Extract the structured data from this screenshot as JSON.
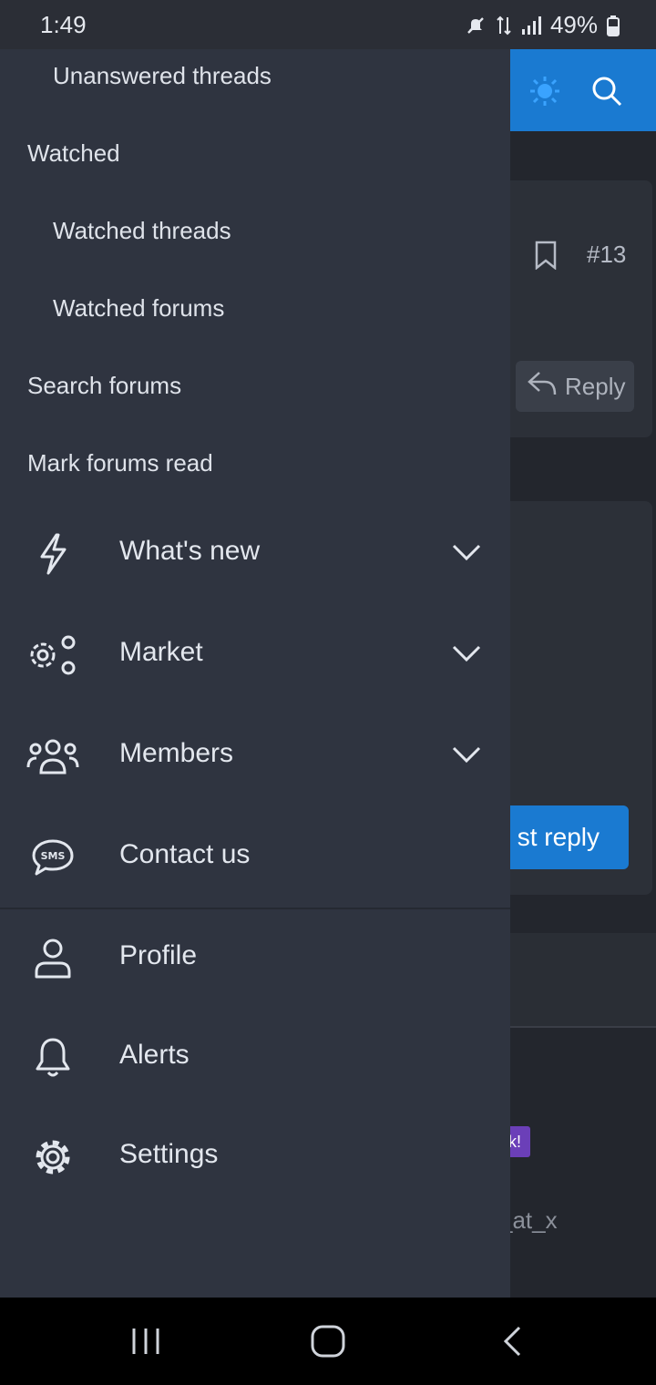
{
  "status_bar": {
    "time": "1:49",
    "battery": "49%"
  },
  "background": {
    "post_number": "#13",
    "reply_label": "Reply",
    "post_reply_fragment": "st reply",
    "badge_fragment": "k!",
    "username_fragment": "_at_x"
  },
  "drawer": {
    "links": [
      {
        "label": "Unanswered threads"
      },
      {
        "label": "Watched"
      },
      {
        "label": "Watched threads"
      },
      {
        "label": "Watched forums"
      },
      {
        "label": "Search forums"
      },
      {
        "label": "Mark forums read"
      }
    ],
    "nav": [
      {
        "label": "What's new",
        "icon": "bolt-icon"
      },
      {
        "label": "Market",
        "icon": "gears-icon"
      },
      {
        "label": "Members",
        "icon": "users-icon"
      },
      {
        "label": "Contact us",
        "icon": "sms-icon"
      }
    ],
    "account": [
      {
        "label": "Profile",
        "icon": "user-icon"
      },
      {
        "label": "Alerts",
        "icon": "bell-icon"
      },
      {
        "label": "Settings",
        "icon": "gear-icon"
      }
    ]
  },
  "colors": {
    "drawer_bg": "#2f3440",
    "header_blue": "#1a7ad1",
    "text": "#dfe3ea"
  }
}
